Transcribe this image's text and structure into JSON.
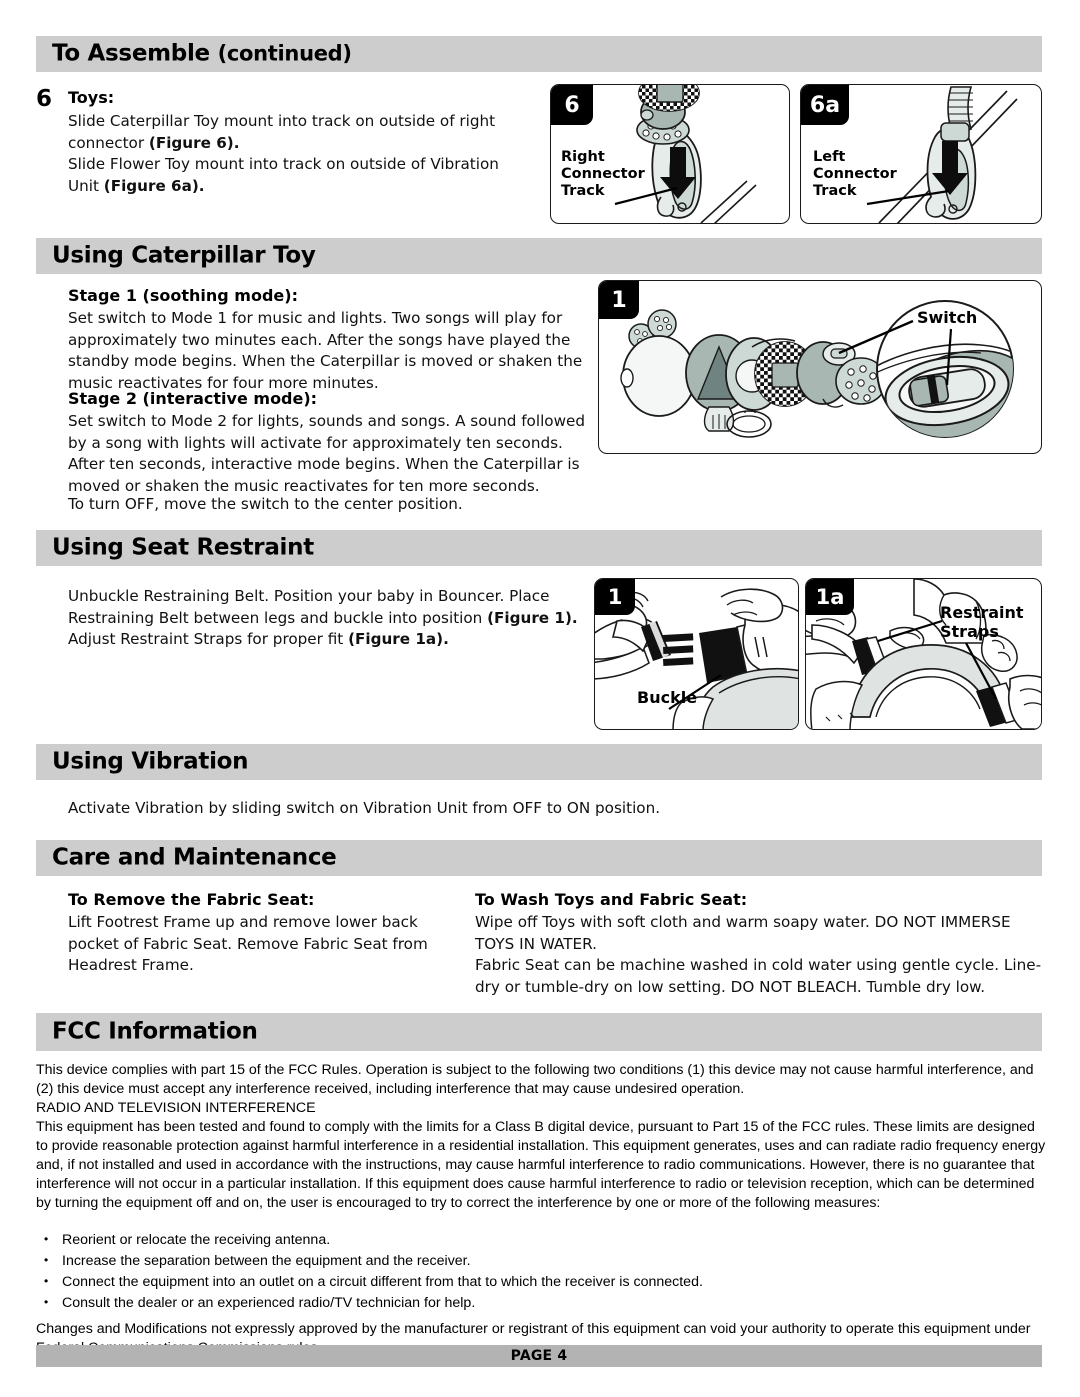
{
  "document": {
    "page_label": "PAGE 4"
  },
  "sections": {
    "assemble": {
      "title_main": "To Assemble",
      "title_cont": "(continued)",
      "step_number": "6",
      "step_heading": "Toys:",
      "para1_a": "Slide Caterpillar Toy mount into track on outside of right connector ",
      "para1_b": "(Figure 6).",
      "para2_a": "Slide Flower Toy mount into track on outside of Vibration Unit ",
      "para2_b": "(Figure 6a)."
    },
    "caterpillar": {
      "title": "Using Caterpillar Toy",
      "stage1_heading": "Stage 1 (soothing mode):",
      "stage1_body": "Set switch to Mode 1 for music and lights. Two songs will play for approximately two minutes each. After the songs have played the standby mode begins. When the Caterpillar is moved or shaken the music reactivates for four more minutes.",
      "stage2_heading": "Stage 2 (interactive mode):",
      "stage2_body": "Set switch to Mode 2 for lights, sounds and songs. A sound followed by a song with lights will activate for approximately ten seconds. After ten seconds, interactive mode begins. When the Caterpillar is moved or shaken the music reactivates for ten more seconds.",
      "off_note": "To turn OFF, move the switch to the center position."
    },
    "restraint": {
      "title": "Using Seat Restraint",
      "body_a": "Unbuckle Restraining Belt. Position your baby in Bouncer. Place Restraining Belt between legs and buckle into position ",
      "body_b": "(Figure 1).",
      "body_c": " Adjust Restraint Straps for proper fit ",
      "body_d": "(Figure 1a)."
    },
    "vibration": {
      "title": "Using Vibration",
      "body": "Activate Vibration by sliding switch on Vibration Unit from OFF to ON position."
    },
    "care": {
      "title": "Care and Maintenance",
      "col1_heading": "To Remove the Fabric Seat:",
      "col1_body": "Lift Footrest Frame up and remove lower back pocket of Fabric Seat. Remove Fabric Seat from Headrest Frame.",
      "col2_heading": "To Wash Toys and Fabric Seat:",
      "col2_body1": "Wipe off Toys with soft cloth and warm soapy water. DO NOT IMMERSE TOYS IN WATER.",
      "col2_body2": "Fabric Seat can be machine washed in cold water using gentle cycle. Line-dry or tumble-dry on low setting. DO NOT BLEACH. Tumble dry low."
    },
    "fcc": {
      "title": "FCC Information",
      "para1": "This device complies with part 15 of the FCC Rules. Operation is subject to the following two conditions (1) this device may not cause harmful interference, and (2) this device must accept any interference received, including interference that may cause undesired operation.",
      "subhead": "RADIO AND TELEVISION INTERFERENCE",
      "para2": "This equipment has been tested and found to comply with the limits for a Class B digital device, pursuant to Part 15 of the FCC rules. These limits are designed to provide reasonable protection against harmful interference in a residential installation. This equipment generates, uses and can radiate radio frequency energy and, if not installed and used in accordance with the instructions, may cause harmful interference to radio communications.   However, there is no guarantee that interference will not occur in a particular installation.  If this equipment does cause harmful interference to radio or television reception, which can be determined by turning the equipment off and on, the user is encouraged to try to correct the interference by one or more of the following measures:",
      "bullets": [
        "Reorient or relocate the receiving antenna.",
        "Increase the separation between the equipment and the receiver.",
        "Connect the equipment into an outlet on a circuit different from that to which the receiver is connected.",
        "Consult the dealer or an experienced radio/TV technician for help."
      ],
      "para3": "Changes and Modifications not expressly approved by the manufacturer or registrant of this equipment can void your authority to operate this equipment under Federal Communications Commissions rules."
    }
  },
  "figures": {
    "fig6": {
      "number": "6",
      "label": "Right\nConnector\nTrack"
    },
    "fig6a": {
      "number": "6a",
      "label": "Left\nConnector\nTrack"
    },
    "fig_caterpillar": {
      "number": "1",
      "label": "Switch"
    },
    "fig_buckle": {
      "number": "1",
      "label": "Buckle"
    },
    "fig_straps": {
      "number": "1a",
      "label": "Restraint\nStraps"
    }
  },
  "colors": {
    "header_bar": "#cdcdcd",
    "footer_bar": "#b3b3b3",
    "figure_gray": "#a8b7b2",
    "figure_light": "#d6e0dc",
    "ink": "#000000"
  }
}
